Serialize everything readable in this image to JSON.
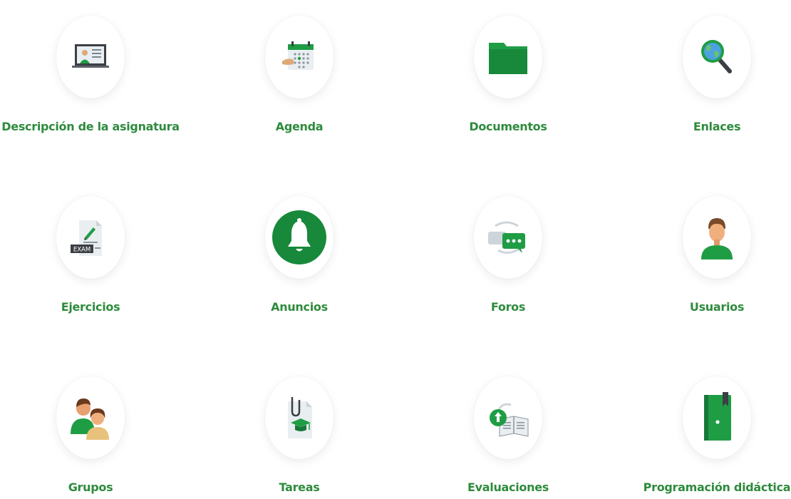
{
  "colors": {
    "accent_green": "#2e8b3d",
    "icon_green": "#1f9d45",
    "dark_green": "#18783a"
  },
  "tools": [
    {
      "label": "Descripción de la asignatura",
      "icon": "presentation-screen-icon"
    },
    {
      "label": "Agenda",
      "icon": "calendar-icon"
    },
    {
      "label": "Documentos",
      "icon": "folder-icon"
    },
    {
      "label": "Enlaces",
      "icon": "globe-magnifier-icon"
    },
    {
      "label": "Ejercicios",
      "icon": "exam-sheet-icon"
    },
    {
      "label": "Anuncios",
      "icon": "bell-icon"
    },
    {
      "label": "Foros",
      "icon": "chat-bubbles-icon"
    },
    {
      "label": "Usuarios",
      "icon": "user-icon"
    },
    {
      "label": "Grupos",
      "icon": "group-icon"
    },
    {
      "label": "Tareas",
      "icon": "assignment-clip-icon"
    },
    {
      "label": "Evaluaciones",
      "icon": "evaluation-book-icon"
    },
    {
      "label": "Programación didáctica",
      "icon": "notebook-icon"
    }
  ],
  "exam_text": "EXAM"
}
